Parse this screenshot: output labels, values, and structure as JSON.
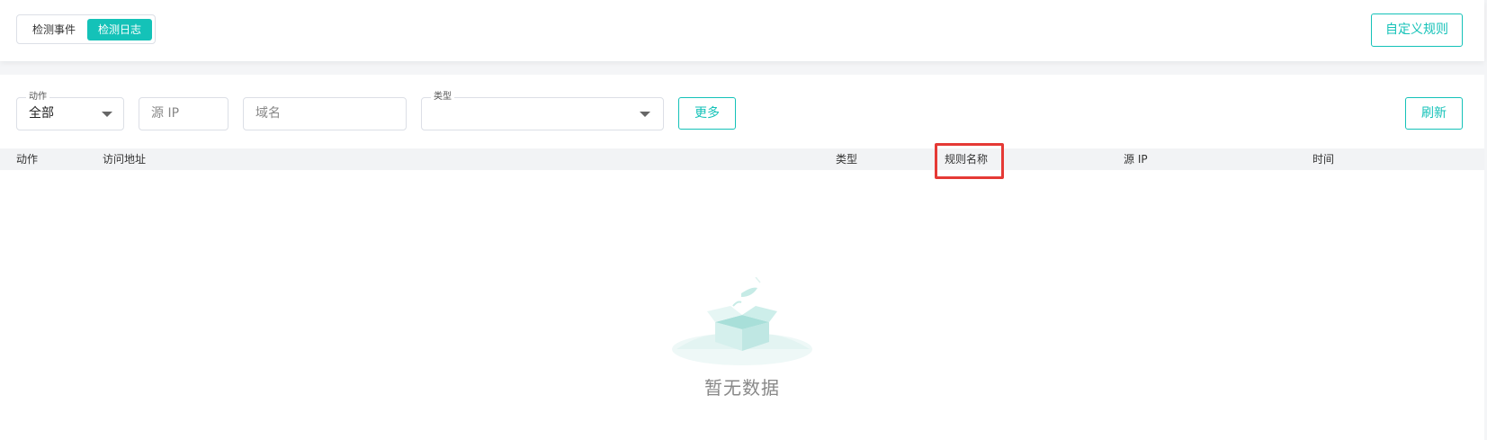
{
  "top_bar": {
    "view_tabs": [
      {
        "label": "检测事件",
        "active": false
      },
      {
        "label": "检测日志",
        "active": true
      }
    ],
    "custom_rules_button": "自定义规则"
  },
  "filters": {
    "action": {
      "label": "动作",
      "value": "全部"
    },
    "source_ip": {
      "placeholder": "源 IP"
    },
    "domain": {
      "placeholder": "域名"
    },
    "type": {
      "label": "类型",
      "value": ""
    },
    "more_button": "更多",
    "refresh_button": "刷新"
  },
  "table": {
    "columns": [
      "动作",
      "访问地址",
      "类型",
      "规则名称",
      "源 IP",
      "时间"
    ],
    "rows": [],
    "empty_text": "暂无数据"
  },
  "colors": {
    "accent": "#14c2b8",
    "highlight": "#e53935"
  }
}
